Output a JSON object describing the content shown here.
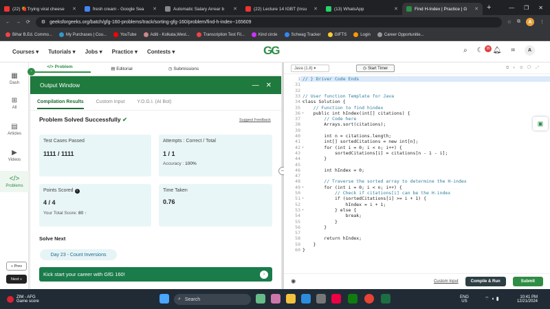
{
  "browser": {
    "tabs": [
      {
        "title": "(22) 🍓Trying viral cheese",
        "color": "#e33"
      },
      {
        "title": "fresh cream - Google Sea",
        "color": "#4285f4"
      },
      {
        "title": "Automatic Salary Arrear b",
        "color": "#888"
      },
      {
        "title": "(22) Lecture 14 IGBT (Insu",
        "color": "#e33"
      },
      {
        "title": "(13) WhatsApp",
        "color": "#25d366"
      },
      {
        "title": "Find H-Index | Practice | G",
        "color": "#2f8d46"
      }
    ],
    "url": "geeksforgeeks.org/batch/gfg-160-problems/track/sorting-gfg-160/problem/find-h-index--165609",
    "bookmarks": [
      "Bihar B.Ed. Commo...",
      "My Purchases | Cou...",
      "YouTube",
      "Aditi - Kolkata,West...",
      "Transcription Test Fil...",
      "Kind circle",
      "Schwag Tracker",
      "GIFTS",
      "Login",
      "Career Opportunitie..."
    ]
  },
  "header": {
    "nav": [
      "Courses ▾",
      "Tutorials ▾",
      "Jobs ▾",
      "Practice ▾",
      "Contests ▾"
    ],
    "logo": "GG",
    "notif_count": "35",
    "avatar": "A"
  },
  "rail": {
    "items": [
      "Dash",
      "All",
      "Articles",
      "Videos",
      "Problems"
    ],
    "prev": "« Prev",
    "next": "Next »"
  },
  "problem_tabs": [
    "</> Problem",
    "Editorial",
    "Submissions"
  ],
  "output": {
    "title": "Output Window",
    "tabs": [
      "Compilation Results",
      "Custom Input",
      "Y.O.G.I. (AI Bot)"
    ],
    "status": "Problem Solved Successfully",
    "feedback": "Suggest Feedback",
    "test_cases_label": "Test Cases Passed",
    "test_cases_value": "1111 / 1111",
    "attempts_label": "Attempts : Correct / Total",
    "attempts_value": "1 / 1",
    "accuracy_label": "Accuracy :",
    "accuracy_value": "100%",
    "points_label": "Points Scored",
    "points_value": "4 / 4",
    "total_label": "Your Total Score:",
    "total_value": "80",
    "time_label": "Time Taken",
    "time_value": "0.76",
    "solve_next": "Solve Next",
    "next_problem": "Day 23 - Count Inversions",
    "promo": "Kick start your career with GfG 160!"
  },
  "editor": {
    "language": "Java (1.8)",
    "timer": "Start Timer",
    "lines": [
      {
        "n": "1",
        "t": "// } Driver Code Ends",
        "cls": "cm"
      },
      {
        "n": "31",
        "t": "",
        "cls": ""
      },
      {
        "n": "32",
        "t": "",
        "cls": ""
      },
      {
        "n": "33",
        "t": "// User function Template for Java",
        "cls": "cm"
      },
      {
        "n": "34",
        "t": "class Solution {",
        "cls": ""
      },
      {
        "n": "35",
        "t": "    // Function to find hindex",
        "cls": "cm"
      },
      {
        "n": "36",
        "t": "    public int hIndex(int[] citations) {",
        "cls": ""
      },
      {
        "n": "37",
        "t": "        // Code here",
        "cls": "cm"
      },
      {
        "n": "38",
        "t": "        Arrays.sort(citations);",
        "cls": ""
      },
      {
        "n": "39",
        "t": "",
        "cls": ""
      },
      {
        "n": "40",
        "t": "        int n = citations.length;",
        "cls": ""
      },
      {
        "n": "41",
        "t": "        int[] sortedCitations = new int[n];",
        "cls": ""
      },
      {
        "n": "42",
        "t": "        for (int i = 0; i < n; i++) {",
        "cls": ""
      },
      {
        "n": "43",
        "t": "            sortedCitations[i] = citations[n - 1 - i];",
        "cls": ""
      },
      {
        "n": "44",
        "t": "        }",
        "cls": ""
      },
      {
        "n": "45",
        "t": "",
        "cls": ""
      },
      {
        "n": "46",
        "t": "        int hIndex = 0;",
        "cls": ""
      },
      {
        "n": "47",
        "t": "",
        "cls": ""
      },
      {
        "n": "48",
        "t": "        // Traverse the sorted array to determine the H-index",
        "cls": "cm"
      },
      {
        "n": "49",
        "t": "        for (int i = 0; i < n; i++) {",
        "cls": ""
      },
      {
        "n": "50",
        "t": "            // Check if citations[i] can be the H-index",
        "cls": "cm"
      },
      {
        "n": "51",
        "t": "            if (sortedCitations[i] >= i + 1) {",
        "cls": ""
      },
      {
        "n": "52",
        "t": "                hIndex = i + 1;",
        "cls": ""
      },
      {
        "n": "53",
        "t": "            } else {",
        "cls": ""
      },
      {
        "n": "54",
        "t": "                break;",
        "cls": ""
      },
      {
        "n": "55",
        "t": "            }",
        "cls": ""
      },
      {
        "n": "56",
        "t": "        }",
        "cls": ""
      },
      {
        "n": "57",
        "t": "",
        "cls": ""
      },
      {
        "n": "58",
        "t": "        return hIndex;",
        "cls": ""
      },
      {
        "n": "59",
        "t": "    }",
        "cls": ""
      },
      {
        "n": "60",
        "t": "}",
        "cls": ""
      }
    ],
    "custom_input": "Custom Input",
    "compile": "Compile & Run",
    "submit": "Submit"
  },
  "taskbar": {
    "weather_line1": "ZIM - AFG",
    "weather_line2": "Game score",
    "search": "Search",
    "lang1": "ENG",
    "lang2": "US",
    "time": "10:41 PM",
    "date": "12/21/2024"
  }
}
